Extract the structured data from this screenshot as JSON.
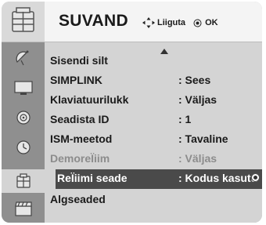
{
  "header": {
    "title": "SUVAND",
    "hint_move": "Liiguta",
    "hint_ok": "OK",
    "icon": "settings-icon"
  },
  "sidebar": {
    "items": [
      {
        "icon": "satellite-dish-icon"
      },
      {
        "icon": "monitor-icon"
      },
      {
        "icon": "speaker-icon"
      },
      {
        "icon": "clock-icon"
      },
      {
        "icon": "settings-icon",
        "active": true
      },
      {
        "icon": "film-clapper-icon"
      }
    ]
  },
  "menu": {
    "rows": [
      {
        "label": "Sisendi silt",
        "value": ""
      },
      {
        "label": "SIMPLINK",
        "value": ": Sees"
      },
      {
        "label": "Klaviatuurilukk",
        "value": ": Väljas"
      },
      {
        "label": "Seadista ID",
        "value": ": 1"
      },
      {
        "label": "ISM-meetod",
        "value": ": Tavaline"
      },
      {
        "label": "DemoreÏiim",
        "value": ": Väljas",
        "disabled": true
      },
      {
        "label": "ReÏiimi seade",
        "value": ": Kodus kasutu",
        "selected": true
      },
      {
        "label": "Algseaded",
        "value": ""
      }
    ]
  },
  "colors": {
    "background": "#b9b9b9",
    "selected_row": "#4a4a4a",
    "disabled_text": "#8c8c8c"
  }
}
